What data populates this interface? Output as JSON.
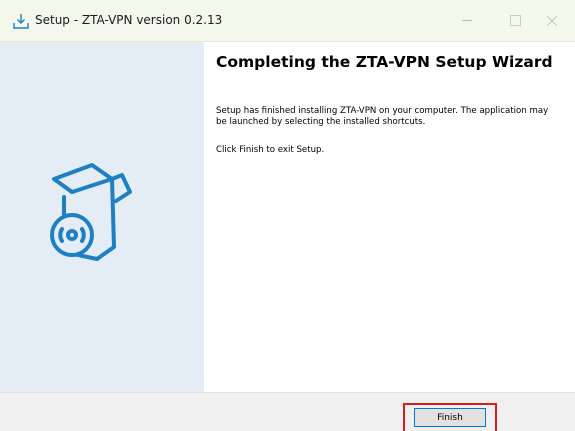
{
  "window": {
    "title": "Setup - ZTA-VPN version 0.2.13",
    "controls": {
      "minimize": "minimize-icon",
      "maximize": "maximize-icon",
      "close": "close-icon"
    }
  },
  "banner": {
    "image": "software-box-disc-icon",
    "accent_color": "#1e7fc3",
    "background": "#e4edf5"
  },
  "content": {
    "heading": "Completing the ZTA-VPN Setup Wizard",
    "paragraph1": "Setup has finished installing ZTA-VPN on your computer. The application may be launched by selecting the installed shortcuts.",
    "paragraph2": "Click Finish to exit Setup."
  },
  "buttons": {
    "finish_label": "Finish"
  },
  "colors": {
    "highlight": "#d21f1f",
    "button_focus": "#0078d7"
  }
}
